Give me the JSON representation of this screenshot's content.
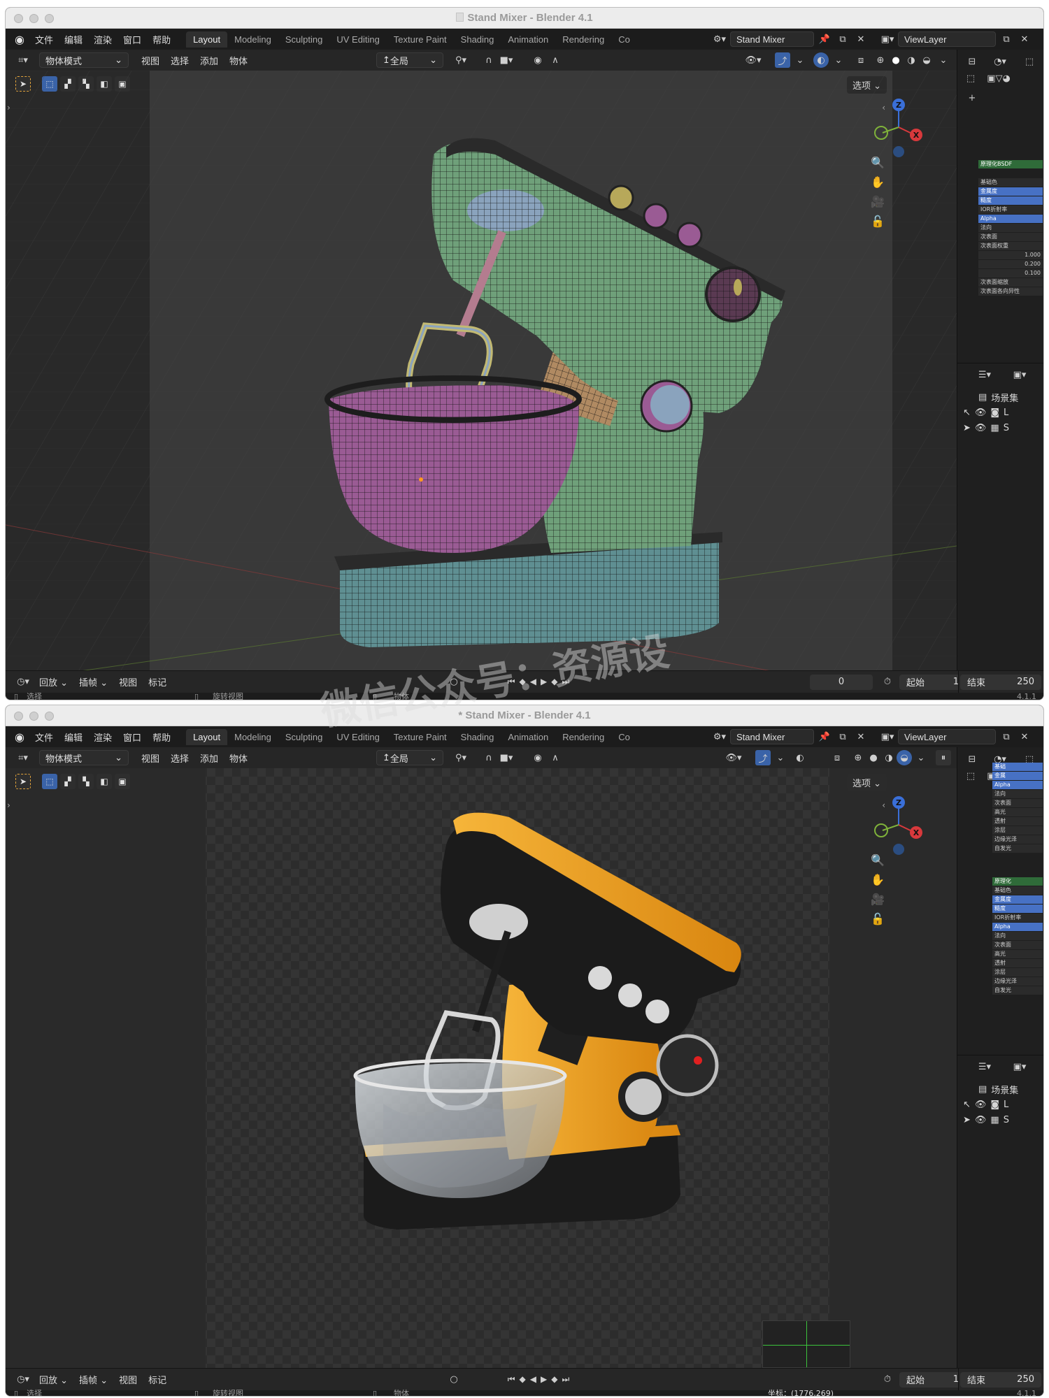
{
  "windows": [
    {
      "title": "Stand Mixer - Blender 4.1",
      "shading_mode": "wireframe-solid",
      "coords": ""
    },
    {
      "title": "* Stand Mixer - Blender 4.1",
      "shading_mode": "rendered",
      "coords": "坐标：(1776,269)"
    }
  ],
  "menu": [
    "文件",
    "编辑",
    "渲染",
    "窗口",
    "帮助"
  ],
  "tabs": [
    "Layout",
    "Modeling",
    "Sculpting",
    "UV Editing",
    "Texture Paint",
    "Shading",
    "Animation",
    "Rendering",
    "Co"
  ],
  "active_tab": "Layout",
  "scene_name": "Stand Mixer",
  "view_layer": "ViewLayer",
  "header": {
    "mode": "物体模式",
    "items": [
      "视图",
      "选择",
      "添加",
      "物体"
    ],
    "transform_space": "全局",
    "options": "选项"
  },
  "timeline": {
    "playback": "回放",
    "keying": "插帧",
    "view": "视图",
    "marker": "标记",
    "current_frame": "0",
    "start_label": "起始",
    "start_value": "1",
    "end_label": "结束",
    "end_value": "250"
  },
  "status": {
    "select": "选择",
    "rotate": "旋转视图",
    "object": "物体",
    "version": "4.1.1"
  },
  "outliner": {
    "scene_collection": "场景集",
    "row1": "L",
    "row2": "S"
  },
  "properties_view_label": "视图",
  "gizmo": {
    "z": "Z",
    "x": "X"
  },
  "watermark": "微信公众号：资源设",
  "material_panel_w1": [
    "原理化BSDF",
    "基础色",
    "金属度",
    "糙度",
    "IOR折射率",
    "Alpha",
    "法向",
    "次表面",
    "次表面权重",
    "1.000",
    "0.200",
    "0.100",
    "次表面缩放",
    "次表面各向异性"
  ],
  "material_panel_w2": [
    "基础",
    "金属",
    "Alpha",
    "法向",
    "次表面",
    "高光",
    "透射",
    "涂层",
    "边缘光泽",
    "自发光",
    "原理化",
    "基础色",
    "金属度",
    "糙度",
    "IOR折射率",
    "Alpha",
    "法向",
    "次表面",
    "高光",
    "透射",
    "涂层",
    "边缘光泽",
    "自发光"
  ],
  "colors": {
    "wire_body": "#6fa07a",
    "wire_bowl": "#9a5b94",
    "wire_base": "#5f8f92",
    "render_orange": "#f0a020",
    "render_black": "#1a1a1a",
    "accent_blue": "#4772b3"
  }
}
